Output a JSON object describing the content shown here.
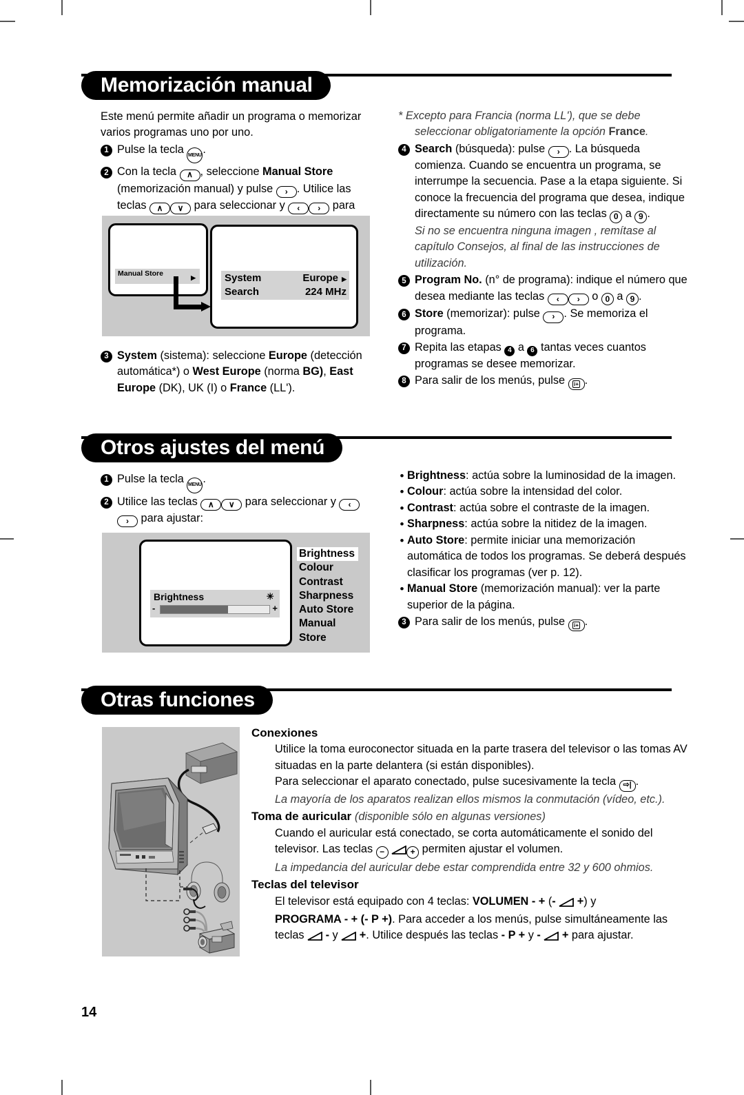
{
  "page": {
    "number": "14"
  },
  "sections": [
    {
      "id": "memorizacion-manual",
      "title": "Memorización manual",
      "left": {
        "intro": "Este menú permite añadir un programa o memorizar varios programas uno por uno.",
        "steps": [
          {
            "n": "1",
            "text_before": "Pulse la tecla ",
            "key": "MENU",
            "text_after": "."
          },
          {
            "n": "2",
            "html_note": "Con la tecla (up), seleccione Manual Store (memorización manual) y pulse (right). Utilice las teclas (up)(down) para seleccionar y (left)(right) para ajustar:"
          },
          {
            "n": "3",
            "html_note": "System (sistema): seleccione Europe (detección automática*) o West Europe (norma BG), East Europe (DK), UK (I) o France (LL')."
          }
        ],
        "figure": {
          "left_item": "Manual Store",
          "rows": [
            {
              "label": "System",
              "value": "Europe"
            },
            {
              "label": "Search",
              "value": "224 MHz"
            }
          ]
        }
      },
      "right": {
        "footnote": "* Excepto para Francia (norma LL'), que se debe seleccionar obligatoriamente la opción France.",
        "footnote_bold": "France",
        "steps": [
          {
            "n": "4",
            "label": "Search",
            "text": "(búsqueda): pulse (right). La búsqueda comienza. Cuando se encuentra un programa, se interrumpe la secuencia. Pase a la etapa siguiente. Si conoce la frecuencia del programa que desea, indique directamente su número con las teclas (0) a (9).",
            "italic_note": "Si no se encuentra ninguna imagen , remítase al capítulo Consejos, al final de las instrucciones de utilización."
          },
          {
            "n": "5",
            "label": "Program No.",
            "text": "(n° de programa): indique el número que desea mediante las teclas (left)(right) o (0) a (9)."
          },
          {
            "n": "6",
            "label": "Store",
            "text": "(memorizar): pulse (right). Se memoriza el programa."
          },
          {
            "n": "7",
            "label": "",
            "text": "Repita las etapas (4) a (6) tantas veces cuantos programas se desee memorizar."
          },
          {
            "n": "8",
            "label": "",
            "text": "Para salir de los menús, pulse (i+)."
          }
        ]
      }
    },
    {
      "id": "otros-ajustes-del-menu",
      "title": "Otros ajustes del menú",
      "left": {
        "steps": [
          {
            "n": "1",
            "text_before": "Pulse la tecla ",
            "key": "MENU",
            "text_after": "."
          },
          {
            "n": "2",
            "html_note": "Utilice las teclas (up)(down) para seleccionar y (left)(right) para ajustar:"
          }
        ],
        "figure": {
          "slider_label": "Brightness",
          "slider_minus": "-",
          "slider_plus": "+",
          "slider_percent": 62,
          "menu_items": [
            "Brightness",
            "Colour",
            "Contrast",
            "Sharpness",
            "Auto Store",
            "Manual Store"
          ],
          "selected_item": "Brightness"
        }
      },
      "right": {
        "bullets": [
          {
            "label": "Brightness",
            "text": ": actúa sobre la luminosidad de la imagen."
          },
          {
            "label": "Colour",
            "text": ": actúa sobre la intensidad del color."
          },
          {
            "label": "Contrast",
            "text": ": actúa sobre el contraste de la imagen."
          },
          {
            "label": "Sharpness",
            "text": ": actúa sobre la nitidez de la imagen."
          },
          {
            "label": "Auto Store",
            "text": ": permite iniciar una memorización automática de todos los programas. Se deberá después clasificar los programas (ver p. 12)."
          },
          {
            "label": "Manual Store",
            "text": " (memorización manual): ver la parte superior de la página."
          }
        ],
        "final_step": {
          "n": "3",
          "text": "Para salir de los menús, pulse (i+)."
        }
      }
    },
    {
      "id": "otras-funciones",
      "title": "Otras funciones",
      "blocks": [
        {
          "heading": "Conexiones",
          "heading_note": "",
          "lines": [
            "Utilice la toma euroconector situada en la parte trasera del televisor o las tomas AV situadas en la parte delantera (si están disponibles).",
            "Para seleccionar el aparato conectado, pulse sucesivamente la tecla (av)."
          ],
          "italic": "La mayoría de los aparatos realizan ellos mismos la conmutación (vídeo, etc.)."
        },
        {
          "heading": "Toma de auricular",
          "heading_note": "(disponible sólo en algunas versiones)",
          "lines": [
            "Cuando el auricular está conectado, se corta automáticamente el sonido del televisor. Las teclas (−) (vol) (+) permiten ajustar el volumen."
          ],
          "italic": "La impedancia del auricular debe estar comprendida entre 32 y 600 ohmios."
        },
        {
          "heading": "Teclas del televisor",
          "heading_note": "",
          "lines": [
            "El televisor está equipado con 4 teclas: VOLUMEN - + (- (vol) +) y",
            "PROGRAMA - + (- P +). Para acceder a los menús, pulse simultáneamente las teclas (vol) - y (vol) +. Utilice después las teclas - P + y - (vol) + para ajustar."
          ],
          "italic": ""
        }
      ]
    }
  ],
  "colors": {
    "pill_bg": "#000000",
    "pill_text": "#ffffff",
    "figure_bg": "#c9c9c9",
    "osd_bar": "#d3d3d3",
    "italic_text": "#3b3b3b"
  },
  "labels": {
    "key_menu": "MENU",
    "key_up": "∧",
    "key_down": "∨",
    "key_left": "‹",
    "key_right": "›",
    "key_zero": "0",
    "key_nine": "9"
  }
}
